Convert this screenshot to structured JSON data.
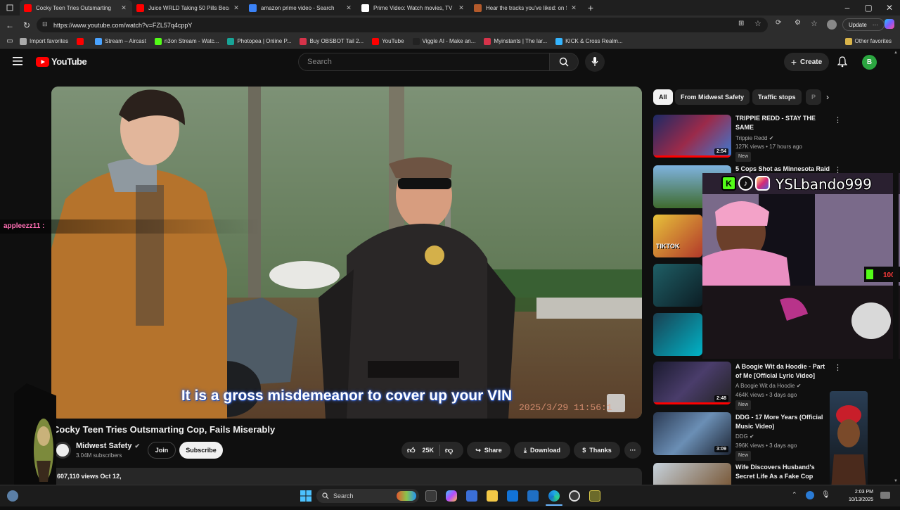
{
  "browser": {
    "tabs": [
      {
        "title": "Cocky Teen Tries Outsmarting",
        "active": true,
        "color": "#ff0000"
      },
      {
        "title": "Juice WRLD Taking 50 Pills Becau",
        "active": false,
        "color": "#ff0000"
      },
      {
        "title": "amazon prime video - Search",
        "active": false,
        "color": "#3b82f6"
      },
      {
        "title": "Prime Video: Watch movies, TV sh",
        "active": false,
        "color": "#ffffff"
      },
      {
        "title": "Hear the tracks you've liked: on S",
        "active": false,
        "color": "#b35a2b"
      }
    ],
    "url": "https://www.youtube.com/watch?v=FZL57q4cppY",
    "update_label": "Update",
    "bookmarks": [
      {
        "label": "Import favorites",
        "color": "#aaaaaa"
      },
      {
        "label": "",
        "color": "#ff0000"
      },
      {
        "label": "Stream – Aircast",
        "color": "#4aa3ff"
      },
      {
        "label": "n3on Stream - Watc...",
        "color": "#53fc18"
      },
      {
        "label": "Photopea | Online P...",
        "color": "#18a497"
      },
      {
        "label": "Buy OBSBOT Tail 2...",
        "color": "#d6334a"
      },
      {
        "label": "YouTube",
        "color": "#ff0000"
      },
      {
        "label": "Viggle AI - Make an...",
        "color": "#222222"
      },
      {
        "label": "Myinstants | The lar...",
        "color": "#d6334a"
      },
      {
        "label": "KICK & Cross Realm...",
        "color": "#35b5ff"
      }
    ],
    "other_favorites": "Other favorites"
  },
  "youtube": {
    "logo_text": "YouTube",
    "search_placeholder": "Search",
    "create_label": "Create",
    "avatar_letter": "B"
  },
  "video": {
    "caption": "It is a gross misdemeanor to cover up your VIN",
    "timestamp_overlay": "2025/3/29  11:56:1",
    "title": "Cocky Teen Tries Outsmarting Cop, Fails Miserably",
    "channel": "Midwest Safety",
    "subscribers": "3.04M subscribers",
    "join_label": "Join",
    "subscribe_label": "Subscribe",
    "likes": "25K",
    "share_label": "Share",
    "download_label": "Download",
    "thanks_label": "Thanks",
    "views_date": "607,110 views  Oct 12,"
  },
  "sidebar": {
    "chips": [
      "All",
      "From Midwest Safety",
      "Traffic stops",
      "P"
    ],
    "recs": [
      {
        "title": "TRIPPIE REDD - STAY THE SAME",
        "channel": "Trippie Redd",
        "meta": "127K views • 17 hours ago",
        "new": "New",
        "duration": "2:54"
      },
      {
        "title": "5 Cops Shot as Minnesota Raid",
        "channel": "",
        "meta": "",
        "new": "",
        "duration": ""
      },
      {
        "title": "A Boogie Wit da Hoodie - Part of Me [Official Lyric Video]",
        "channel": "A Boogie Wit da Hoodie",
        "meta": "464K views • 3 days ago",
        "new": "New",
        "duration": "2:48"
      },
      {
        "title": "DDG - 17 More Years (Official Music Video)",
        "channel": "DDG",
        "meta": "396K views • 3 days ago",
        "new": "New",
        "duration": "3:09"
      },
      {
        "title": "Wife Discovers Husband's Secret Life As a Fake Cop",
        "channel": "",
        "meta": "",
        "new": "",
        "duration": ""
      }
    ]
  },
  "overlay": {
    "streamer_name": "YSLbando999",
    "chat_user": "appleezz11 :",
    "tiktok_text": "TIKTOK",
    "kick_number": "100"
  },
  "taskbar": {
    "search_label": "Search",
    "time": "2:03 PM",
    "date": "10/13/2025"
  }
}
